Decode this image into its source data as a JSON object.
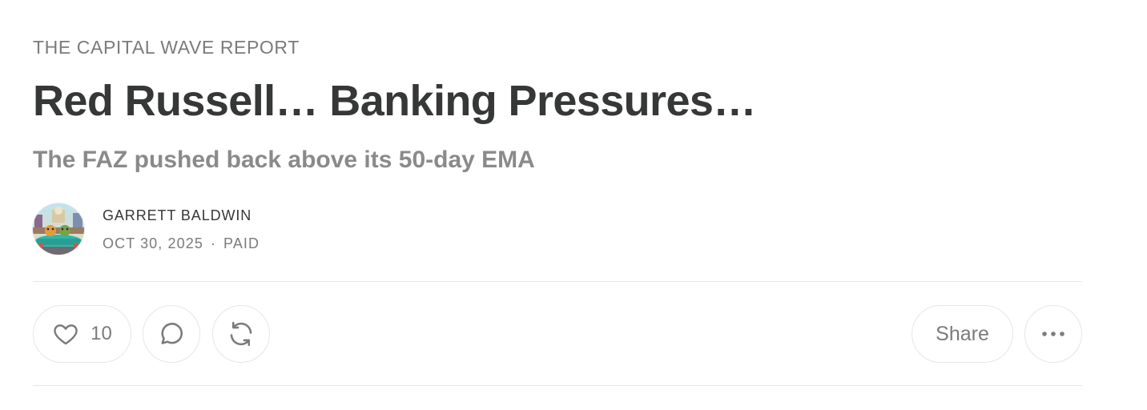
{
  "publication": {
    "name": "THE CAPITAL WAVE REPORT"
  },
  "post": {
    "title": "Red Russell… Banking Pressures…",
    "subtitle": "The FAZ pushed back above its 50-day EMA"
  },
  "byline": {
    "author": "GARRETT BALDWIN",
    "date": "OCT 30, 2025",
    "separator": "·",
    "access": "PAID",
    "avatar_icon": "author-avatar"
  },
  "actions": {
    "like": {
      "icon": "heart-icon",
      "count": "10"
    },
    "comment": {
      "icon": "comment-bubble-icon"
    },
    "restack": {
      "icon": "restack-arrows-icon"
    },
    "share": {
      "label": "Share"
    },
    "more": {
      "icon": "ellipsis-icon"
    }
  },
  "colors": {
    "title": "#363737",
    "muted": "#7b7b7b",
    "divider": "#e6e6e6",
    "background": "#ffffff"
  }
}
